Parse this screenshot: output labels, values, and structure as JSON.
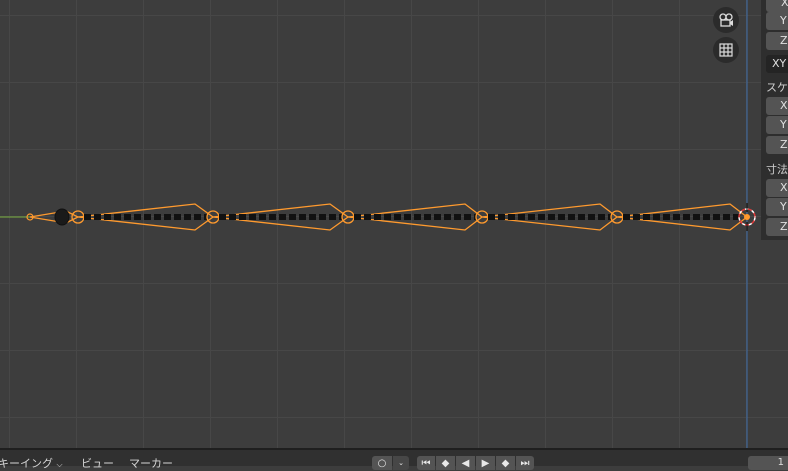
{
  "panel": {
    "x1_label": "X",
    "y1_label": "Y",
    "z1_label": "Z",
    "mode_label": "XY",
    "scale_heading": "スケ",
    "x2_label": "X",
    "y2_label": "Y",
    "z2_label": "Z",
    "dimensions_heading": "寸法",
    "x3_label": "X",
    "y3_label": "Y",
    "z3_label": "Z"
  },
  "viewport": {
    "camera_toggle_icon": "camera-icon",
    "grid_toggle_icon": "grid-icon",
    "selection_color": "#ff9a2e",
    "bone_color": "#1a1a1a"
  },
  "timeline": {
    "menu_keying": "キーイング",
    "menu_view": "ビュー",
    "menu_marker": "マーカー",
    "current_frame": "1"
  }
}
